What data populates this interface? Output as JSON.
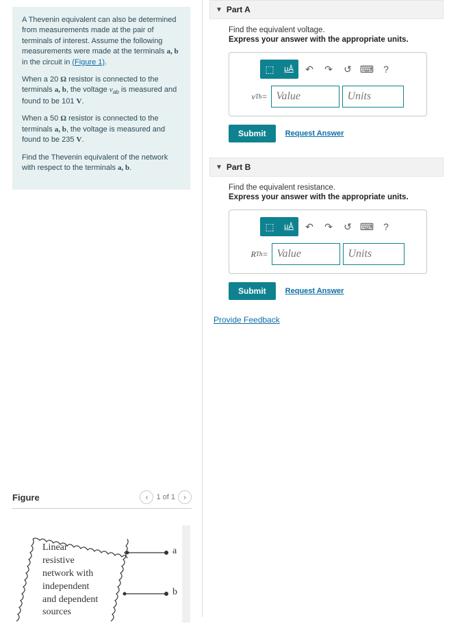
{
  "problem": {
    "p1_a": "A Thevenin equivalent can also be determined from measurements made at the pair of terminals of interest. Assume the following measurements were made at the terminals ",
    "p1_ab": "a, b",
    "p1_b": " in the circuit in ",
    "p1_link": "(Figure 1)",
    "p1_c": ".",
    "p2_a": "When a 20 ",
    "p2_unit": "Ω",
    "p2_b": " resistor is connected to the terminals ",
    "p2_ab": "a, b",
    "p2_c": ", the voltage ",
    "p2_var": "v",
    "p2_sub": "ab",
    "p2_d": " is measured and found to be 101 ",
    "p2_v": "V",
    "p2_e": ".",
    "p3_a": "When a 50 ",
    "p3_unit": "Ω",
    "p3_b": " resistor is connected to the terminals ",
    "p3_ab": "a, b",
    "p3_c": ", the voltage is measured and found to be 235 ",
    "p3_v": "V",
    "p3_d": ".",
    "p4_a": "Find the Thevenin equivalent of the network with respect to the terminals ",
    "p4_ab": "a, b",
    "p4_b": "."
  },
  "partA": {
    "header": "Part A",
    "find": "Find the equivalent voltage.",
    "express": "Express your answer with the appropriate units.",
    "var_html": "v",
    "var_sub": "Th",
    "eq": " =",
    "value_ph": "Value",
    "units_ph": "Units",
    "submit": "Submit",
    "request": "Request Answer"
  },
  "partB": {
    "header": "Part B",
    "find": "Find the equivalent resistance.",
    "express": "Express your answer with the appropriate units.",
    "var_html": "R",
    "var_sub": "Th",
    "eq": " =",
    "value_ph": "Value",
    "units_ph": "Units",
    "submit": "Submit",
    "request": "Request Answer"
  },
  "toolbar": {
    "templates": "⬚",
    "units_btn": "μÅ",
    "undo": "↶",
    "redo": "↷",
    "reset": "↺",
    "keyboard": "⌨",
    "help": "?"
  },
  "feedback": "Provide Feedback",
  "figure": {
    "title": "Figure",
    "prev": "‹",
    "page": "1 of 1",
    "next": "›",
    "box_l1": "Linear",
    "box_l2": "resistive",
    "box_l3": "network with",
    "box_l4": "independent",
    "box_l5": "and dependent",
    "box_l6": "sources",
    "term_a": "a",
    "term_b": "b"
  }
}
